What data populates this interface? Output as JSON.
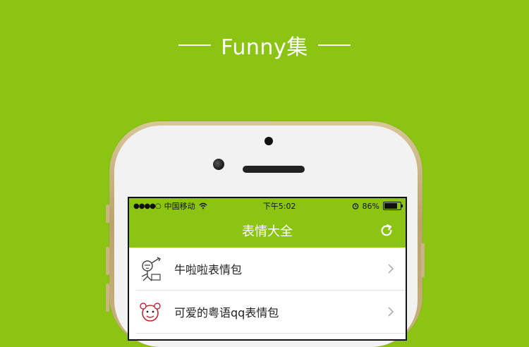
{
  "banner": {
    "title": "Funny集"
  },
  "status_bar": {
    "signal_dots": "●●●●○",
    "carrier": "中国移动",
    "time": "下午5:02",
    "battery_percent": "86%"
  },
  "nav": {
    "title": "表情大全",
    "refresh_icon": "refresh-icon"
  },
  "list": [
    {
      "label": "牛啦啦表情包",
      "icon": "stick-figure-icon"
    },
    {
      "label": "可爱的粤语qq表情包",
      "icon": "cartoon-face-icon"
    }
  ],
  "colors": {
    "brand_green": "#8cc414",
    "phone_gold": "#c7b07a"
  }
}
